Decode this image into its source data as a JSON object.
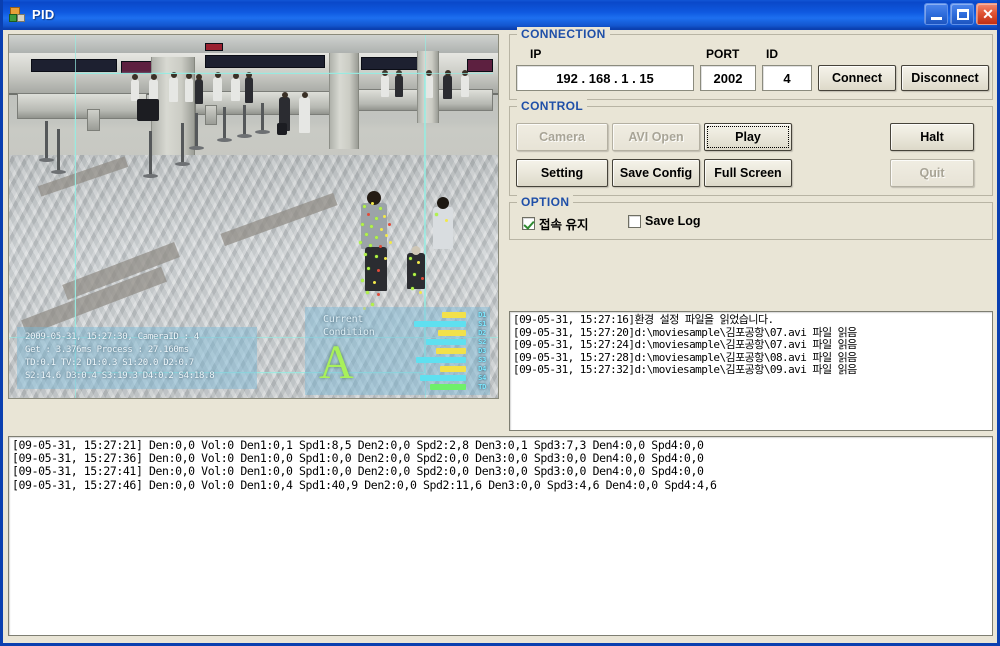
{
  "window": {
    "title": "PID",
    "icon": "app-icon",
    "buttons": {
      "minimize": "–",
      "maximize": "□",
      "close": "✕"
    }
  },
  "connection": {
    "title": "CONNECTION",
    "ip_label": "IP",
    "ip_value": "192 . 168 .  1   . 15",
    "port_label": "PORT",
    "port_value": "2002",
    "id_label": "ID",
    "id_value": "4",
    "connect_label": "Connect",
    "disconnect_label": "Disconnect"
  },
  "control": {
    "title": "CONTROL",
    "camera_label": "Camera",
    "avi_open_label": "AVI Open",
    "play_label": "Play",
    "halt_label": "Halt",
    "setting_label": "Setting",
    "save_config_label": "Save Config",
    "full_screen_label": "Full Screen",
    "quit_label": "Quit"
  },
  "option": {
    "title": "OPTION",
    "keep_connection_label": "접속 유지",
    "keep_connection_checked": true,
    "save_log_label": "Save Log",
    "save_log_checked": false
  },
  "video": {
    "osd_stats": [
      "2009-05-31, 15:27:30, CameraID : 4",
      "Get : 3.376ms Process : 27.160ms",
      "TD:0.1 TV:2 D1:0.3 S1:20.0 D2:0.7",
      "S2:14.6 D3:0.4 S3:19.3 D4:0.2 S4:18.8"
    ],
    "condition_label_line1": "Current",
    "condition_label_line2": "Condition",
    "condition_grade": "A",
    "bars": [
      {
        "name": "D1",
        "type": "d",
        "value": 24
      },
      {
        "name": "S1",
        "type": "s",
        "value": 52
      },
      {
        "name": "D2",
        "type": "d",
        "value": 28
      },
      {
        "name": "S2",
        "type": "s",
        "value": 40
      },
      {
        "name": "D3",
        "type": "d",
        "value": 30
      },
      {
        "name": "S3",
        "type": "s",
        "value": 50
      },
      {
        "name": "D4",
        "type": "d",
        "value": 26
      },
      {
        "name": "S4",
        "type": "s",
        "value": 46
      },
      {
        "name": "TD",
        "type": "td",
        "value": 36
      }
    ]
  },
  "log_top": {
    "lines": [
      "[09-05-31, 15:27:16]환경 설정 파일을 읽었습니다.",
      "[09-05-31, 15:27:20]d:\\moviesample\\김포공항\\07.avi 파일 읽음",
      "[09-05-31, 15:27:24]d:\\moviesample\\김포공항\\07.avi 파일 읽음",
      "[09-05-31, 15:27:28]d:\\moviesample\\김포공항\\08.avi 파일 읽음",
      "[09-05-31, 15:27:32]d:\\moviesample\\김포공항\\09.avi 파일 읽음"
    ]
  },
  "log_bottom": {
    "lines": [
      "[09-05-31, 15:27:21] Den:0,0 Vol:0 Den1:0,1 Spd1:8,5 Den2:0,0 Spd2:2,8 Den3:0,1 Spd3:7,3 Den4:0,0 Spd4:0,0",
      "[09-05-31, 15:27:36] Den:0,0 Vol:0 Den1:0,0 Spd1:0,0 Den2:0,0 Spd2:0,0 Den3:0,0 Spd3:0,0 Den4:0,0 Spd4:0,0",
      "[09-05-31, 15:27:41] Den:0,0 Vol:0 Den1:0,0 Spd1:0,0 Den2:0,0 Spd2:0,0 Den3:0,0 Spd3:0,0 Den4:0,0 Spd4:0,0",
      "[09-05-31, 15:27:46] Den:0,0 Vol:0 Den1:0,4 Spd1:40,9 Den2:0,0 Spd2:11,6 Den3:0,0 Spd3:4,6 Den4:0,0 Spd4:4,6"
    ]
  },
  "colors": {
    "titlebar_blue": "#0f59e0",
    "window_border": "#0a3fb0",
    "face": "#e9e5d6",
    "group_title": "#1f4fa8",
    "grade_green": "#a8f05a",
    "bar_density": "#f2e14a",
    "bar_speed": "#5fe0f0",
    "bar_total": "#6ef06a"
  }
}
